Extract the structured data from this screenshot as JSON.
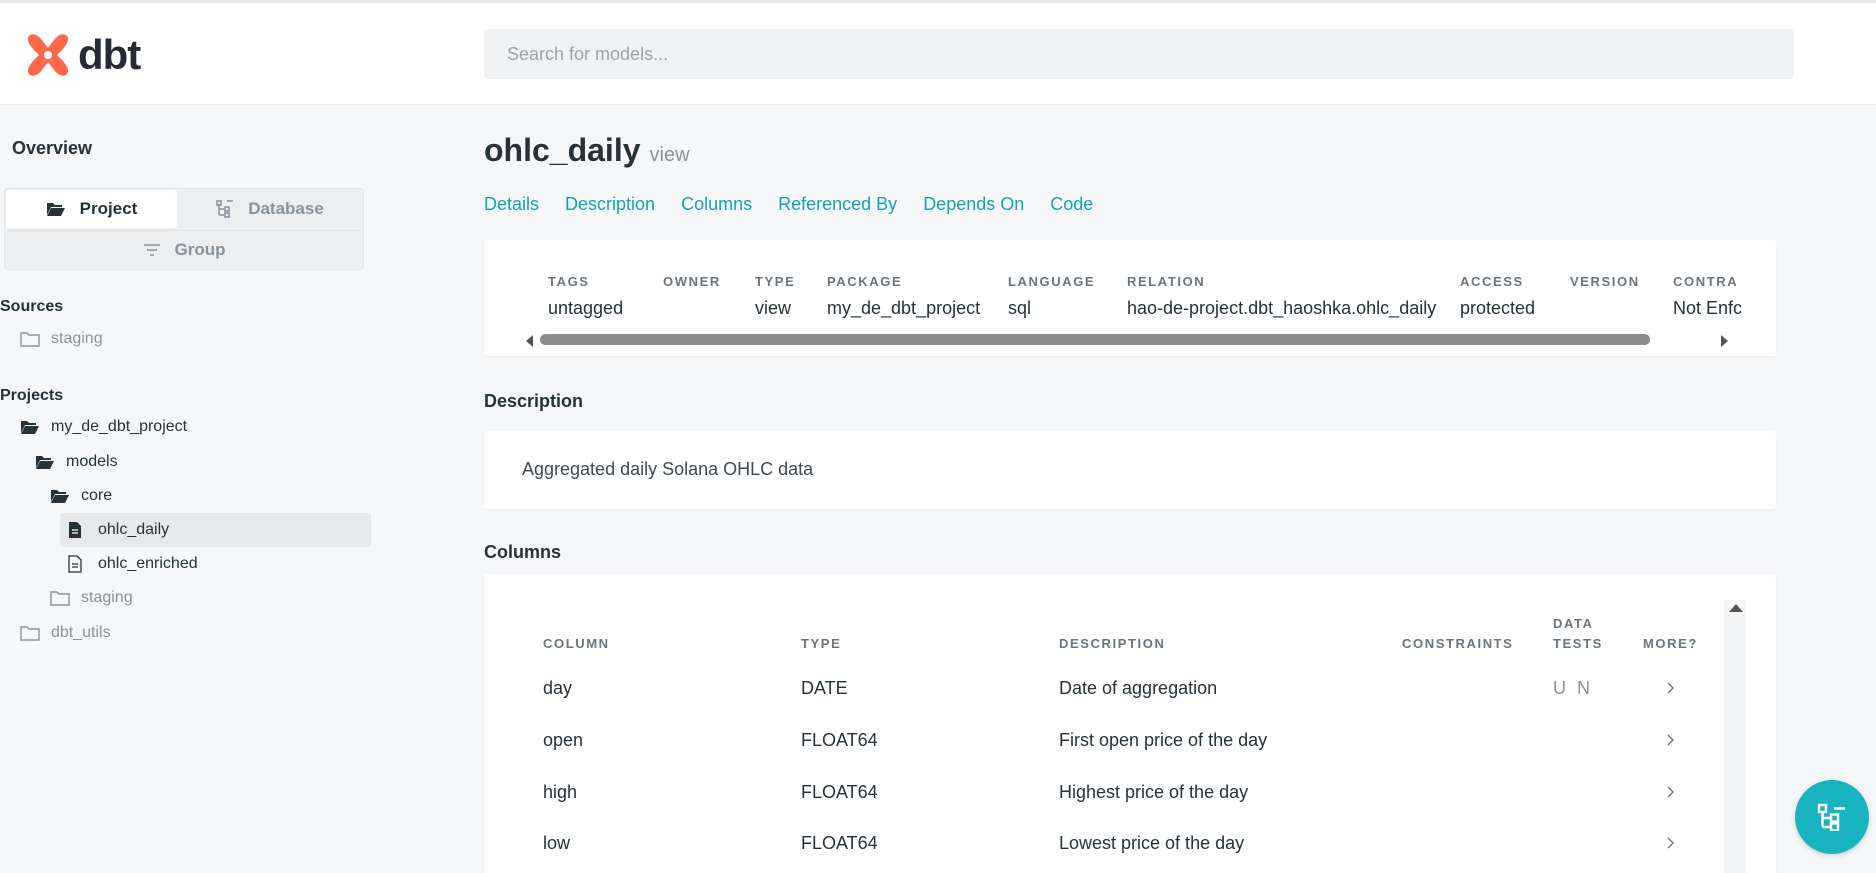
{
  "brand": {
    "name": "dbt",
    "color": "#ff694a"
  },
  "search": {
    "placeholder": "Search for models..."
  },
  "sidebar": {
    "overview": "Overview",
    "toggle": {
      "project": "Project",
      "database": "Database",
      "group": "Group",
      "active": "Project"
    },
    "sources_title": "Sources",
    "sources": [
      {
        "label": "staging",
        "icon": "folder-outline-icon"
      }
    ],
    "projects_title": "Projects",
    "tree": [
      {
        "label": "my_de_dbt_project",
        "icon": "folder-open-icon"
      },
      {
        "label": "models",
        "icon": "folder-open-icon"
      },
      {
        "label": "core",
        "icon": "folder-open-icon"
      },
      {
        "label": "ohlc_daily",
        "icon": "file-filled-icon",
        "selected": true
      },
      {
        "label": "ohlc_enriched",
        "icon": "file-outline-icon"
      },
      {
        "label": "staging",
        "icon": "folder-outline-icon"
      },
      {
        "label": "dbt_utils",
        "icon": "folder-outline-icon"
      }
    ]
  },
  "model": {
    "name": "ohlc_daily",
    "kind": "view"
  },
  "tabs": [
    "Details",
    "Description",
    "Columns",
    "Referenced By",
    "Depends On",
    "Code"
  ],
  "details": [
    {
      "label": "TAGS",
      "value": "untagged"
    },
    {
      "label": "OWNER",
      "value": ""
    },
    {
      "label": "TYPE",
      "value": "view"
    },
    {
      "label": "PACKAGE",
      "value": "my_de_dbt_project"
    },
    {
      "label": "LANGUAGE",
      "value": "sql"
    },
    {
      "label": "RELATION",
      "value": "hao-de-project.dbt_haoshka.ohlc_daily"
    },
    {
      "label": "ACCESS",
      "value": "protected"
    },
    {
      "label": "VERSION",
      "value": ""
    },
    {
      "label": "CONTRA",
      "value": "Not Enfc"
    }
  ],
  "description": {
    "title": "Description",
    "text": "Aggregated daily Solana OHLC data"
  },
  "columns": {
    "title": "Columns",
    "headers": {
      "column": "COLUMN",
      "type": "TYPE",
      "description": "DESCRIPTION",
      "constraints": "CONSTRAINTS",
      "tests_1": "DATA",
      "tests_2": "TESTS",
      "more": "MORE?"
    },
    "rows": [
      {
        "name": "day",
        "type": "DATE",
        "description": "Date of aggregation",
        "tests": "U N"
      },
      {
        "name": "open",
        "type": "FLOAT64",
        "description": "First open price of the day",
        "tests": ""
      },
      {
        "name": "high",
        "type": "FLOAT64",
        "description": "Highest price of the day",
        "tests": ""
      },
      {
        "name": "low",
        "type": "FLOAT64",
        "description": "Lowest price of the day",
        "tests": ""
      }
    ]
  },
  "colors": {
    "accent": "#0ea5b7",
    "fab": "#19b3c2"
  }
}
